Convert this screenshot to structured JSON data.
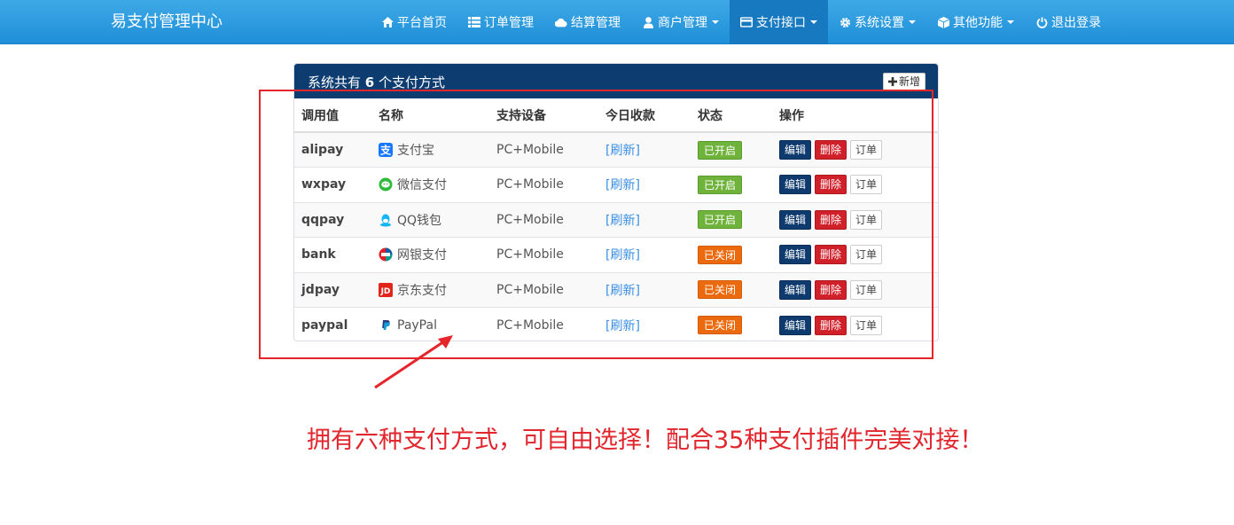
{
  "navbar": {
    "brand": "易支付管理中心",
    "items": [
      {
        "label": "平台首页",
        "icon": "home-icon"
      },
      {
        "label": "订单管理",
        "icon": "list-icon"
      },
      {
        "label": "结算管理",
        "icon": "cloud-icon"
      },
      {
        "label": "商户管理",
        "icon": "user-icon"
      },
      {
        "label": "支付接口",
        "icon": "credit-card-icon"
      },
      {
        "label": "系统设置",
        "icon": "gear-icon"
      },
      {
        "label": "其他功能",
        "icon": "cube-icon"
      },
      {
        "label": "退出登录",
        "icon": "power-icon"
      }
    ]
  },
  "panel": {
    "title_prefix": "系统共有",
    "count": "6",
    "title_suffix": "个支付方式",
    "add_label": "新增"
  },
  "table": {
    "headers": [
      "调用值",
      "名称",
      "支持设备",
      "今日收款",
      "状态",
      "操作"
    ],
    "rows": [
      {
        "code": "alipay",
        "name": "支付宝",
        "icon": "alipay-icon",
        "device": "PC+Mobile",
        "refresh": "[刷新]",
        "status": "已开启"
      },
      {
        "code": "wxpay",
        "name": "微信支付",
        "icon": "wechat-icon",
        "device": "PC+Mobile",
        "refresh": "[刷新]",
        "status": "已开启"
      },
      {
        "code": "qqpay",
        "name": "QQ钱包",
        "icon": "qq-icon",
        "device": "PC+Mobile",
        "refresh": "[刷新]",
        "status": "已开启"
      },
      {
        "code": "bank",
        "name": "网银支付",
        "icon": "unionpay-icon",
        "device": "PC+Mobile",
        "refresh": "[刷新]",
        "status": "已关闭"
      },
      {
        "code": "jdpay",
        "name": "京东支付",
        "icon": "jd-icon",
        "device": "PC+Mobile",
        "refresh": "[刷新]",
        "status": "已关闭"
      },
      {
        "code": "paypal",
        "name": "PayPal",
        "icon": "paypal-icon",
        "device": "PC+Mobile",
        "refresh": "[刷新]",
        "status": "已关闭"
      }
    ],
    "actions": {
      "edit": "编辑",
      "delete": "删除",
      "orders": "订单"
    }
  },
  "annotation": "拥有六种支付方式，可自由选择！配合35种支付插件完美对接！",
  "colors": {
    "navbar": "#2a9be0",
    "panel_heading": "#0c3c70",
    "status_on": "#6fb33c",
    "status_off": "#ec6a0e",
    "annotation": "#e1262d"
  }
}
